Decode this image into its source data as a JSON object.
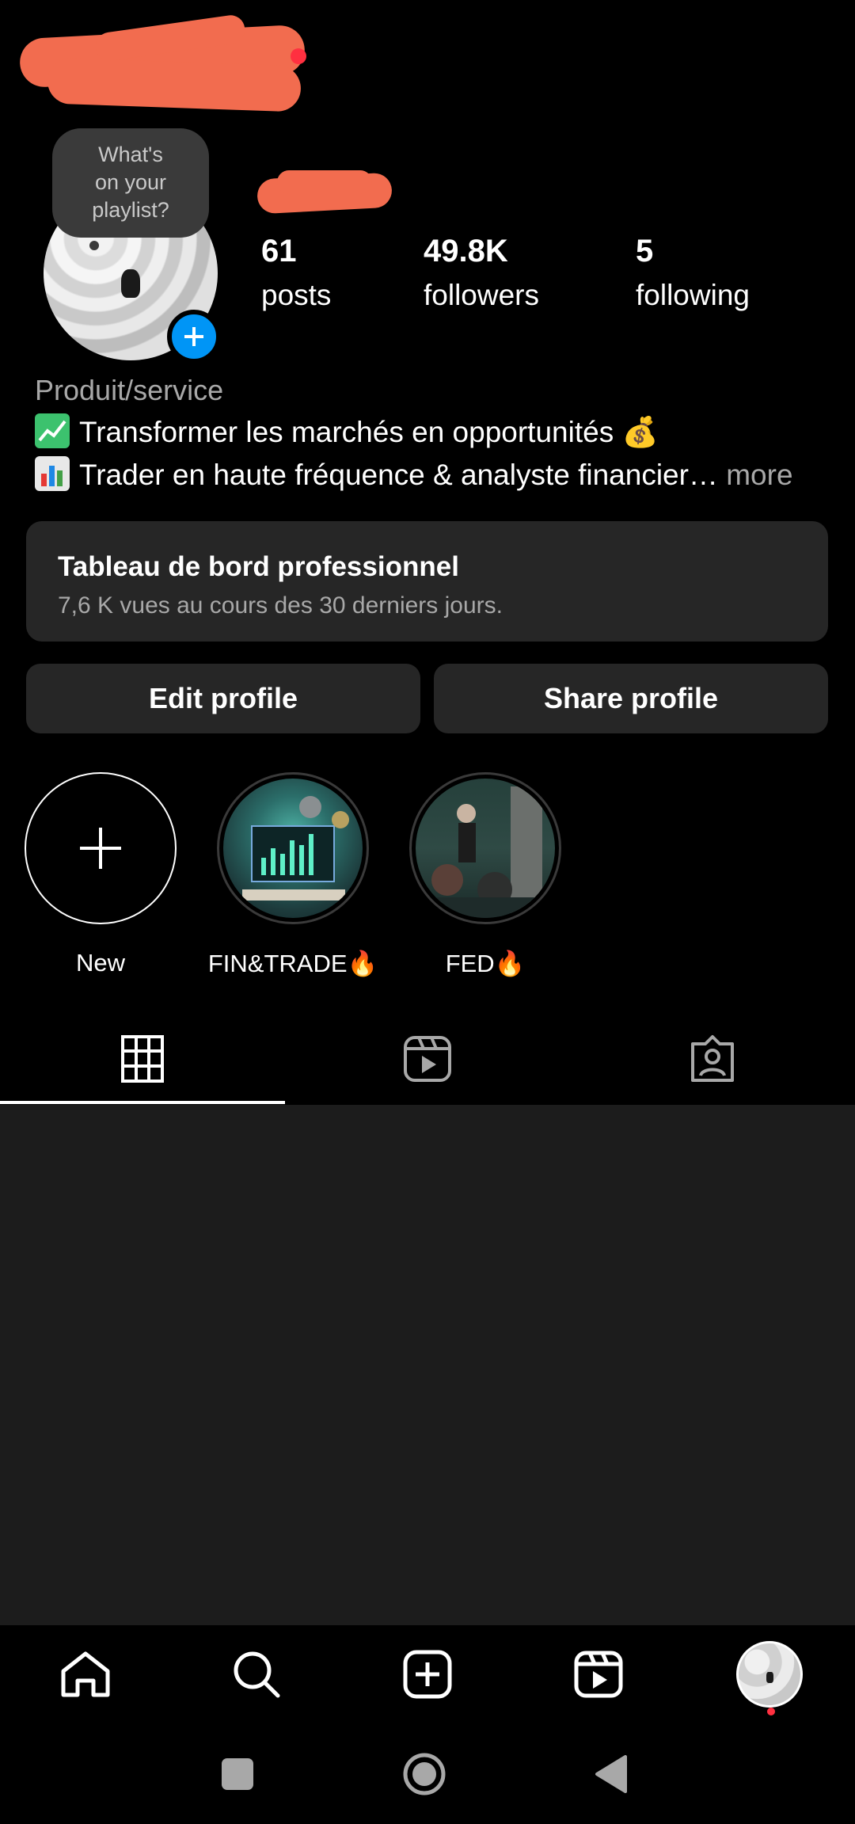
{
  "header": {
    "username_redacted": true
  },
  "profile": {
    "bubble_text_lines": [
      "What's",
      "on your",
      "playlist?"
    ],
    "stats": [
      {
        "value": "61",
        "label": "posts"
      },
      {
        "value": "49.8K",
        "label": "followers"
      },
      {
        "value": "5",
        "label": "following"
      }
    ],
    "category": "Produit/service",
    "bio_line1": "Transformer les marchés en opportunités",
    "bio_line1_end_emoji": "💰",
    "bio_line2": "Trader en haute fréquence & analyste financier…",
    "bio_more": "more"
  },
  "dashboard": {
    "title": "Tableau de bord professionnel",
    "subtitle": "7,6 K vues au cours des 30 derniers jours."
  },
  "buttons": {
    "edit": "Edit profile",
    "share": "Share profile"
  },
  "highlights": [
    {
      "label": "New"
    },
    {
      "label": "FIN&TRADE🔥"
    },
    {
      "label": "FED🔥"
    }
  ],
  "tabs": [
    {
      "icon": "grid-icon",
      "active": true
    },
    {
      "icon": "reels-icon",
      "active": false
    },
    {
      "icon": "tagged-icon",
      "active": false
    }
  ],
  "bottom_nav": [
    {
      "icon": "home-icon"
    },
    {
      "icon": "search-icon"
    },
    {
      "icon": "create-icon"
    },
    {
      "icon": "reels-icon"
    },
    {
      "icon": "profile-avatar"
    }
  ],
  "colors": {
    "background": "#000000",
    "surface": "#262626",
    "accent_blue": "#0095f6",
    "notification_red": "#ff3040",
    "redaction": "#f26c4f"
  }
}
